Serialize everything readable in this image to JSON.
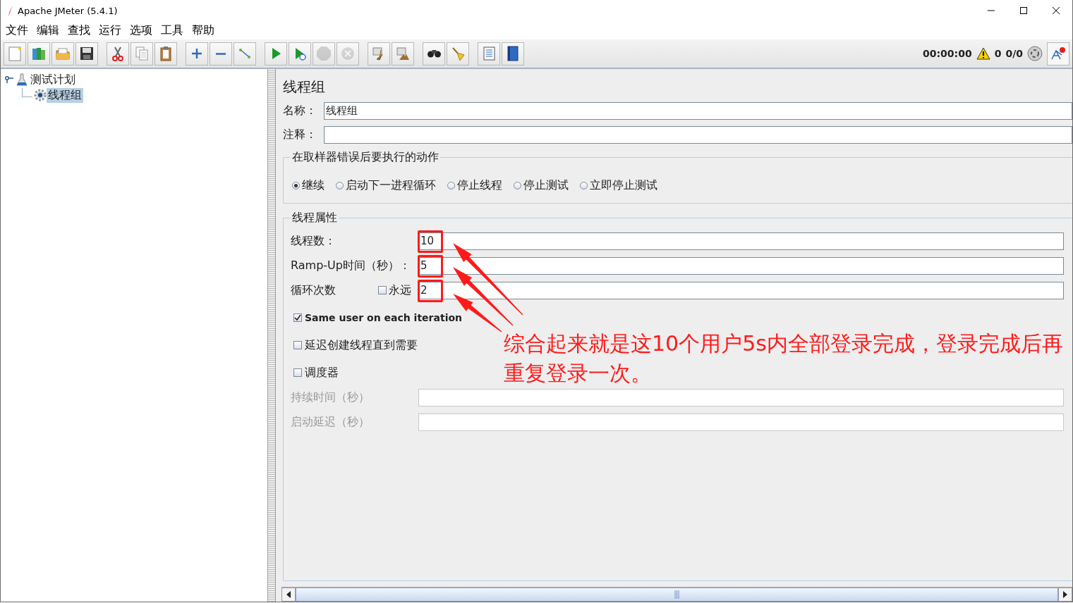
{
  "window": {
    "title": "Apache JMeter (5.4.1)"
  },
  "menu": [
    "文件",
    "编辑",
    "查找",
    "运行",
    "选项",
    "工具",
    "帮助"
  ],
  "toolbar": [
    [
      {
        "kind": "new",
        "disabled": false
      },
      {
        "kind": "templates",
        "disabled": false
      },
      {
        "kind": "open",
        "disabled": false
      },
      {
        "kind": "save",
        "disabled": false
      }
    ],
    [
      {
        "kind": "cut",
        "disabled": false
      },
      {
        "kind": "copy",
        "disabled": false
      },
      {
        "kind": "paste",
        "disabled": false
      }
    ],
    [
      {
        "kind": "expand",
        "disabled": false
      },
      {
        "kind": "collapse",
        "disabled": false
      },
      {
        "kind": "toggle",
        "disabled": false
      }
    ],
    [
      {
        "kind": "start",
        "disabled": false
      },
      {
        "kind": "start-no-timers",
        "disabled": false
      },
      {
        "kind": "stop",
        "disabled": true
      },
      {
        "kind": "shutdown",
        "disabled": true
      }
    ],
    [
      {
        "kind": "clear",
        "disabled": false
      },
      {
        "kind": "clear-all",
        "disabled": false
      }
    ],
    [
      {
        "kind": "search",
        "disabled": false
      },
      {
        "kind": "reset-search",
        "disabled": false
      }
    ],
    [
      {
        "kind": "function-helper",
        "disabled": false
      },
      {
        "kind": "help",
        "disabled": false
      }
    ]
  ],
  "status": {
    "timer": "00:00:00",
    "warnings": "0",
    "threads": "0/0"
  },
  "tree": [
    {
      "label": "测试计划",
      "kind": "test-plan",
      "expanded": true,
      "selected": false,
      "children": [
        {
          "label": "线程组",
          "kind": "thread-group",
          "selected": true
        }
      ]
    }
  ],
  "panel": {
    "title": "线程组",
    "name_label": "名称：",
    "name_value": "线程组",
    "comment_label": "注释：",
    "error_action": {
      "title": "在取样器错误后要执行的动作",
      "options": [
        {
          "label": "继续",
          "selected": true
        },
        {
          "label": "启动下一进程循环",
          "selected": false
        },
        {
          "label": "停止线程",
          "selected": false
        },
        {
          "label": "停止测试",
          "selected": false
        },
        {
          "label": "立即停止测试",
          "selected": false
        }
      ]
    },
    "thread_properties": {
      "title": "线程属性",
      "rows": [
        {
          "kind": "field",
          "label": "线程数：",
          "value": "10",
          "highlighted": true,
          "disabled": false
        },
        {
          "kind": "field",
          "label": "Ramp-Up时间（秒）：",
          "value": "5",
          "highlighted": true,
          "disabled": false
        },
        {
          "kind": "field",
          "label": "循环次数",
          "checkbox": {
            "label": "永远",
            "checked": false
          },
          "value": "2",
          "highlighted": true,
          "disabled": false
        },
        {
          "kind": "checkbox",
          "label": "Same user on each iteration",
          "checked": true
        },
        {
          "kind": "checkbox",
          "label": "延迟创建线程直到需要",
          "checked": false
        },
        {
          "kind": "checkbox",
          "label": "调度器",
          "checked": false
        },
        {
          "kind": "field",
          "label": "持续时间（秒）",
          "highlighted": false,
          "disabled": true
        },
        {
          "kind": "field",
          "label": "启动延迟（秒）",
          "highlighted": false,
          "disabled": true
        }
      ]
    }
  },
  "annotation": {
    "text": "综合起来就是这10个用户5s内全部登录完成，登录完成后再重复登录一次。"
  }
}
